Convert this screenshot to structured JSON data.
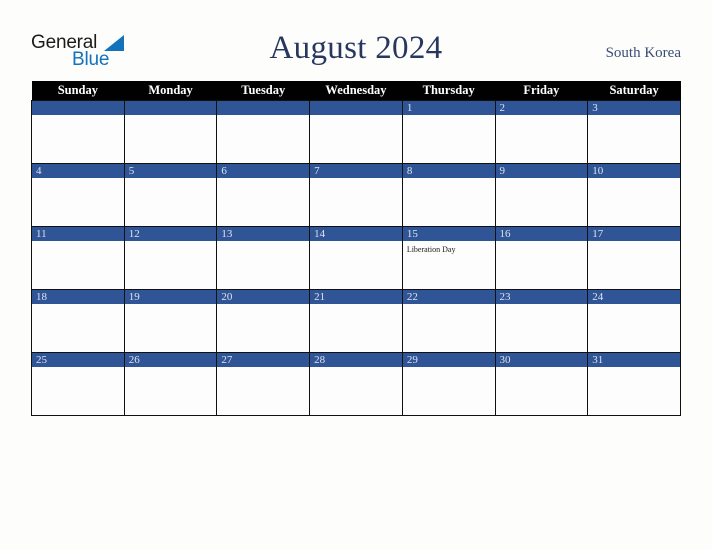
{
  "brand": {
    "word_one": "General",
    "word_two": "Blue",
    "triangle_icon": "triangle-icon",
    "colors": {
      "blue": "#1272bb",
      "dark": "#1c1c1c"
    }
  },
  "header": {
    "title": "August 2024",
    "country": "South Korea"
  },
  "calendar": {
    "weekday_headers": [
      "Sunday",
      "Monday",
      "Tuesday",
      "Wednesday",
      "Thursday",
      "Friday",
      "Saturday"
    ],
    "colors": {
      "header_background": "#010101",
      "header_text": "#ffffff",
      "date_band": "#2f5597",
      "date_text": "#dfe3ec",
      "cell_background": "#fdfdfd",
      "cell_border": "#111111"
    },
    "weeks": [
      [
        {
          "date": "",
          "events": []
        },
        {
          "date": "",
          "events": []
        },
        {
          "date": "",
          "events": []
        },
        {
          "date": "",
          "events": []
        },
        {
          "date": "1",
          "events": []
        },
        {
          "date": "2",
          "events": []
        },
        {
          "date": "3",
          "events": []
        }
      ],
      [
        {
          "date": "4",
          "events": []
        },
        {
          "date": "5",
          "events": []
        },
        {
          "date": "6",
          "events": []
        },
        {
          "date": "7",
          "events": []
        },
        {
          "date": "8",
          "events": []
        },
        {
          "date": "9",
          "events": []
        },
        {
          "date": "10",
          "events": []
        }
      ],
      [
        {
          "date": "11",
          "events": []
        },
        {
          "date": "12",
          "events": []
        },
        {
          "date": "13",
          "events": []
        },
        {
          "date": "14",
          "events": []
        },
        {
          "date": "15",
          "events": [
            "Liberation Day"
          ]
        },
        {
          "date": "16",
          "events": []
        },
        {
          "date": "17",
          "events": []
        }
      ],
      [
        {
          "date": "18",
          "events": []
        },
        {
          "date": "19",
          "events": []
        },
        {
          "date": "20",
          "events": []
        },
        {
          "date": "21",
          "events": []
        },
        {
          "date": "22",
          "events": []
        },
        {
          "date": "23",
          "events": []
        },
        {
          "date": "24",
          "events": []
        }
      ],
      [
        {
          "date": "25",
          "events": []
        },
        {
          "date": "26",
          "events": []
        },
        {
          "date": "27",
          "events": []
        },
        {
          "date": "28",
          "events": []
        },
        {
          "date": "29",
          "events": []
        },
        {
          "date": "30",
          "events": []
        },
        {
          "date": "31",
          "events": []
        }
      ]
    ]
  }
}
